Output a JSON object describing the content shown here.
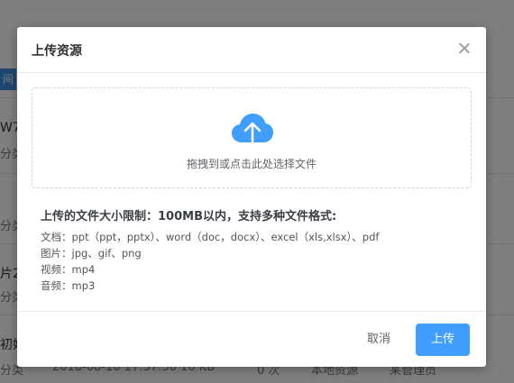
{
  "background": {
    "tag_label": "间",
    "row_labels": [
      "W7",
      "分类",
      "分类",
      "片2",
      "分类",
      "初始",
      "分类"
    ],
    "footer_meta": [
      "2018-08-10 17:37:50",
      "16 KB",
      "0 次",
      "本地资源",
      "某管理员"
    ]
  },
  "dialog": {
    "title": "上传资源",
    "dropzone_text": "拖拽到或点击此处选择文件",
    "limits_title": "上传的文件大小限制：100MB以内，支持多种文件格式:",
    "limits": [
      "文档：ppt（ppt，pptx）、word（doc，docx）、excel（xls,xlsx）、pdf",
      "图片：jpg、gif、png",
      "视频：mp4",
      "音频：mp3"
    ],
    "cancel_label": "取消",
    "upload_label": "上传"
  },
  "colors": {
    "primary": "#409eff",
    "overlay": "rgba(0,0,0,0.5)",
    "cloud": "#409eff"
  },
  "icons": [
    "close-icon",
    "cloud-upload-icon"
  ]
}
